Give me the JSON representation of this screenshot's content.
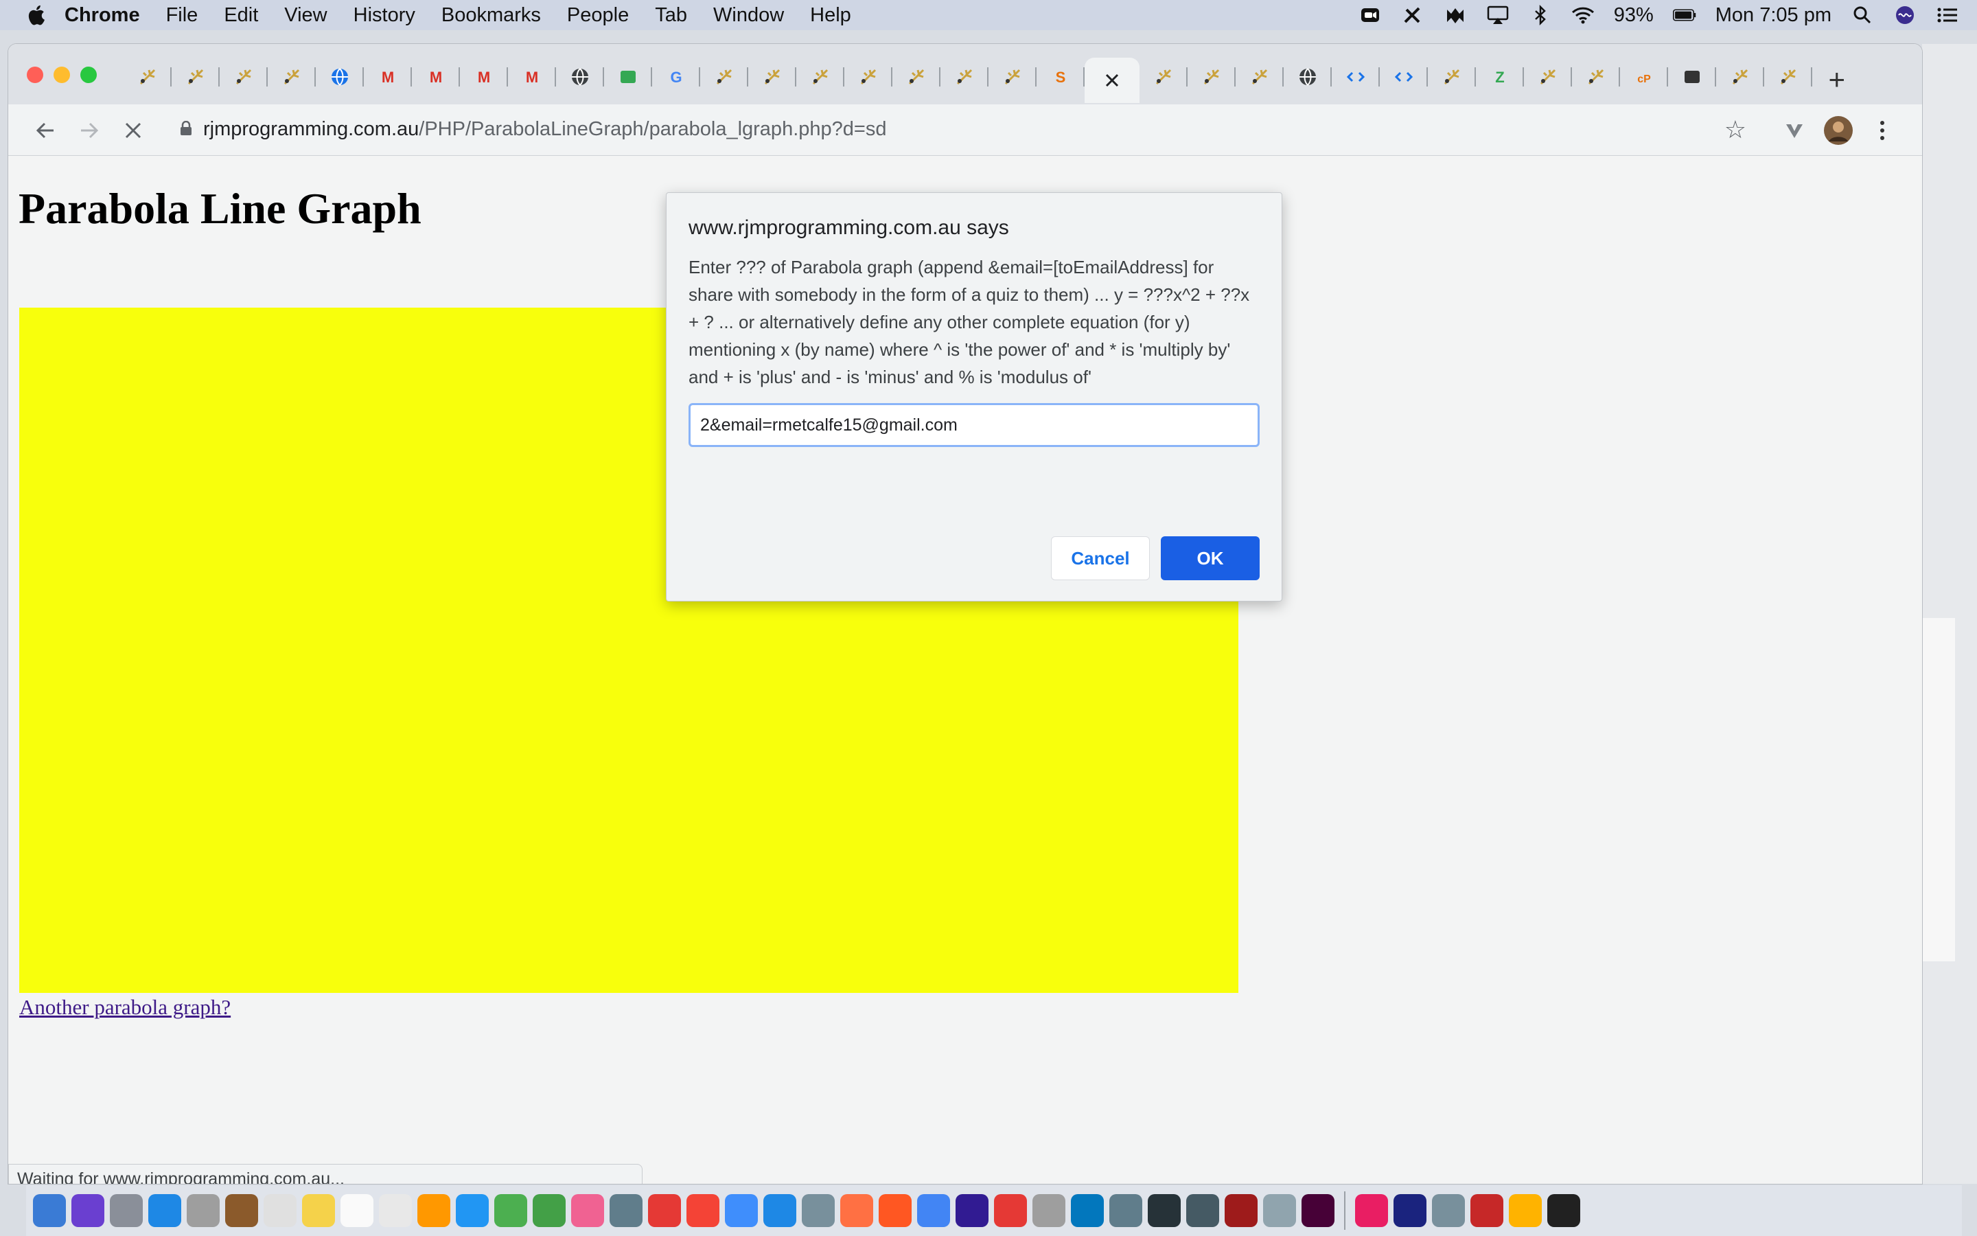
{
  "menubar": {
    "app_name": "Chrome",
    "items": [
      "File",
      "Edit",
      "View",
      "History",
      "Bookmarks",
      "People",
      "Tab",
      "Window",
      "Help"
    ],
    "battery": "93%",
    "clock": "Mon 7:05 pm"
  },
  "browser": {
    "url_host": "rjmprogramming.com.au",
    "url_path": "/PHP/ParabolaLineGraph/parabola_lgraph.php?d=sd",
    "tab_count": 35,
    "active_tab_index": 20
  },
  "page": {
    "title": "Parabola Line Graph",
    "canvas_color": "#f8ff0c",
    "another_link": "Another parabola graph?",
    "status": "Waiting for www.rjmprogramming.com.au..."
  },
  "dialog": {
    "title": "www.rjmprogramming.com.au says",
    "message": "Enter ??? of Parabola graph (append &email=[toEmailAddress] for share with somebody in the form of a quiz to them) ... y = ???x^2 + ??x + ? ... or alternatively define any other complete equation (for y) mentioning x (by name) where ^ is 'the power of' and * is 'multiply by' and + is 'plus' and - is 'minus' and % is 'modulus of'",
    "input_value": "2&email=rmetcalfe15@gmail.com",
    "cancel_label": "Cancel",
    "ok_label": "OK"
  }
}
